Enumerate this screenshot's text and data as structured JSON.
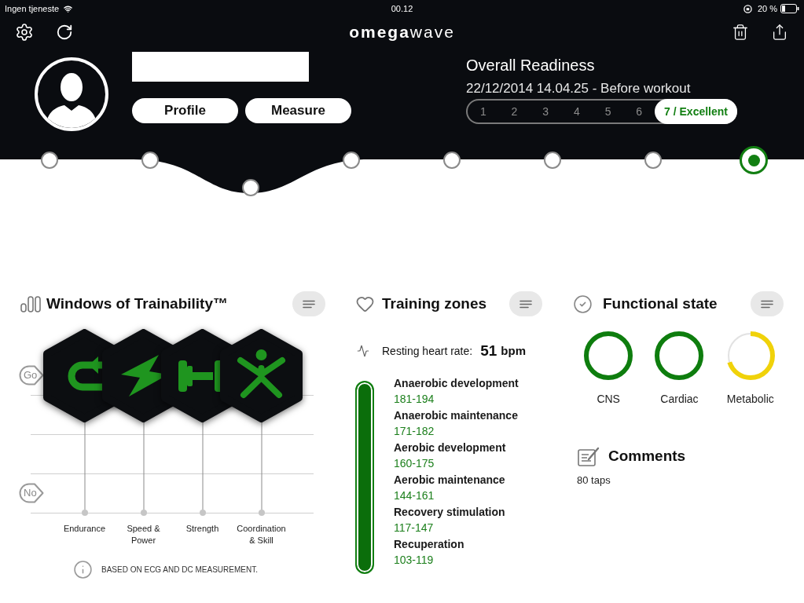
{
  "status_bar": {
    "carrier": "Ingen tjeneste",
    "time": "00.12",
    "battery": "20 %"
  },
  "toolbar": {
    "logo": "**omega**wave"
  },
  "profile": {
    "buttons": [
      {
        "label": "Profile"
      },
      {
        "label": "Measure"
      }
    ]
  },
  "readiness": {
    "title": "Overall Readiness",
    "measurement": "22/12/2014 14.04.25 - Before workout",
    "scale": [
      {
        "label": "1",
        "selected": false
      },
      {
        "label": "2",
        "selected": false
      },
      {
        "label": "3",
        "selected": false
      },
      {
        "label": "4",
        "selected": false
      },
      {
        "label": "5",
        "selected": false
      },
      {
        "label": "6",
        "selected": false
      },
      {
        "label": "7 / Excellent",
        "selected": true
      }
    ]
  },
  "timeline": [
    {
      "selected": false
    },
    {
      "selected": false
    },
    {
      "selected": false
    },
    {
      "selected": false
    },
    {
      "selected": false
    },
    {
      "selected": false
    },
    {
      "selected": false
    },
    {
      "selected": true
    }
  ],
  "windows_of_trainability": {
    "title": "Windows of Trainability™",
    "axis_labels": [
      "Go",
      "No"
    ],
    "windows": [
      {
        "label": "Endurance",
        "open": true
      },
      {
        "label": "Speed & Power",
        "open": true
      },
      {
        "label": "Strength",
        "open": true
      },
      {
        "label": "Coordination & Skill",
        "open": true
      }
    ],
    "note": "BASED ON ECG AND DC MEASUREMENT."
  },
  "training_zones": {
    "title": "Training zones",
    "resting_heart_rate": {
      "label": "Resting heart rate:",
      "value": "51",
      "unit": "bpm"
    },
    "zones": [
      {
        "name": "Anaerobic development",
        "range": "181-194"
      },
      {
        "name": "Anaerobic maintenance",
        "range": "171-182"
      },
      {
        "name": "Aerobic development",
        "range": "160-175"
      },
      {
        "name": "Aerobic maintenance",
        "range": "144-161"
      },
      {
        "name": "Recovery stimulation",
        "range": "117-147"
      },
      {
        "name": "Recuperation",
        "range": "103-119"
      }
    ]
  },
  "functional_state": {
    "title": "Functional state",
    "indicators": [
      {
        "label": "CNS",
        "level": 1,
        "color": "#0e7d0e"
      },
      {
        "label": "Cardiac",
        "level": 1,
        "color": "#0e7d0e"
      },
      {
        "label": "Metabolic",
        "level": 0.7,
        "color": "#f0d20a"
      }
    ]
  },
  "comments": {
    "title": "Comments",
    "text": "80 taps"
  }
}
